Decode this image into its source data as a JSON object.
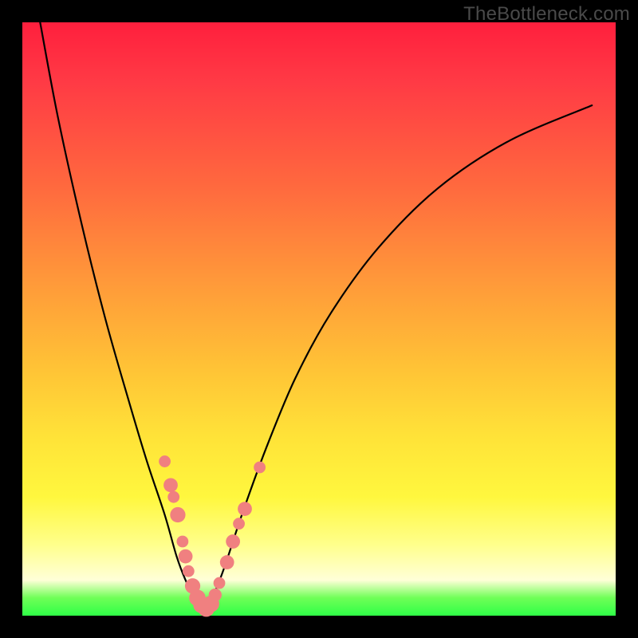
{
  "watermark": "TheBottleneck.com",
  "colors": {
    "curve": "#000000",
    "marker_fill": "#f08080",
    "marker_stroke": "#e06a6a",
    "frame": "#000000"
  },
  "chart_data": {
    "type": "line",
    "title": "",
    "xlabel": "",
    "ylabel": "",
    "xlim": [
      0,
      100
    ],
    "ylim": [
      0,
      100
    ],
    "grid": false,
    "legend": false,
    "series": [
      {
        "name": "bottleneck-curve",
        "x": [
          3,
          6,
          10,
          14,
          18,
          21,
          24,
          26,
          27.5,
          29,
          30.5,
          32,
          34,
          37,
          41,
          46,
          52,
          60,
          70,
          82,
          96
        ],
        "y": [
          100,
          84,
          66,
          50,
          36,
          26,
          17,
          10,
          6,
          3,
          1,
          3,
          8,
          17,
          28,
          40,
          51,
          62,
          72,
          80,
          86
        ]
      }
    ],
    "markers": [
      {
        "x": 24.0,
        "y": 26.0,
        "r": 1.0
      },
      {
        "x": 25.0,
        "y": 22.0,
        "r": 1.2
      },
      {
        "x": 25.5,
        "y": 20.0,
        "r": 1.0
      },
      {
        "x": 26.2,
        "y": 17.0,
        "r": 1.3
      },
      {
        "x": 27.0,
        "y": 12.5,
        "r": 1.0
      },
      {
        "x": 27.5,
        "y": 10.0,
        "r": 1.2
      },
      {
        "x": 28.0,
        "y": 7.5,
        "r": 1.0
      },
      {
        "x": 28.7,
        "y": 5.0,
        "r": 1.3
      },
      {
        "x": 29.5,
        "y": 3.0,
        "r": 1.4
      },
      {
        "x": 30.2,
        "y": 1.8,
        "r": 1.4
      },
      {
        "x": 31.0,
        "y": 1.2,
        "r": 1.4
      },
      {
        "x": 31.8,
        "y": 2.0,
        "r": 1.4
      },
      {
        "x": 32.5,
        "y": 3.5,
        "r": 1.1
      },
      {
        "x": 33.2,
        "y": 5.5,
        "r": 1.0
      },
      {
        "x": 34.5,
        "y": 9.0,
        "r": 1.2
      },
      {
        "x": 35.5,
        "y": 12.5,
        "r": 1.2
      },
      {
        "x": 36.5,
        "y": 15.5,
        "r": 1.0
      },
      {
        "x": 37.5,
        "y": 18.0,
        "r": 1.2
      },
      {
        "x": 40.0,
        "y": 25.0,
        "r": 1.0
      }
    ]
  }
}
